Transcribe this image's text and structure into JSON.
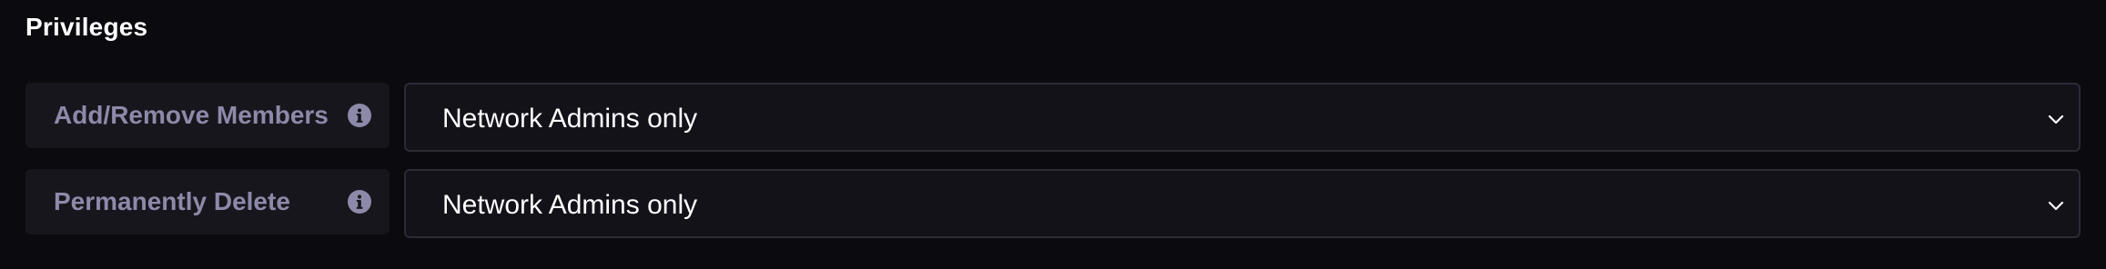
{
  "privileges": {
    "title": "Privileges",
    "rows": [
      {
        "label": "Add/Remove Members",
        "info_icon": "info-icon",
        "selected": "Network Admins only",
        "dropdown_icon": "chevron-down-icon"
      },
      {
        "label": "Permanently Delete",
        "info_icon": "info-icon",
        "selected": "Network Admins only",
        "dropdown_icon": "chevron-down-icon"
      }
    ]
  },
  "colors": {
    "background": "#0b0a0e",
    "label_bg": "#17161d",
    "label_text": "#8d89a8",
    "select_bg": "#131219",
    "select_border": "#2b2a35",
    "text": "#ffffff"
  }
}
